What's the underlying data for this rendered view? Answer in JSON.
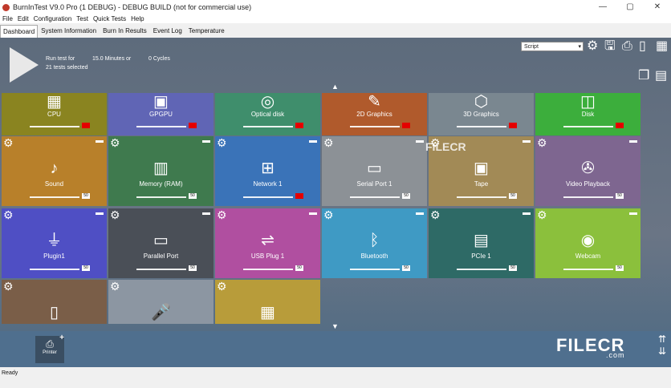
{
  "window": {
    "title": "BurnInTest V9.0 Pro (1 DEBUG) - DEBUG BUILD (not for commercial use)",
    "min": "—",
    "max": "▢",
    "close": "✕"
  },
  "menu": [
    "File",
    "Edit",
    "Configuration",
    "Test",
    "Quick Tests",
    "Help"
  ],
  "tabs": [
    "Dashboard",
    "System Information",
    "Burn In Results",
    "Event Log",
    "Temperature"
  ],
  "run": {
    "label1": "Run test for",
    "duration": "15.0 Minutes or",
    "cycles": "0 Cycles",
    "label2": "21 tests selected"
  },
  "script_select": "Script",
  "tiles": [
    {
      "name": "CPU",
      "icon": "▦",
      "icon_name": "cpu-chip-icon",
      "color": "#8a8420",
      "badge": "",
      "err": true
    },
    {
      "name": "GPGPU",
      "icon": "▣",
      "icon_name": "gpu-card-icon",
      "color": "#6065b5",
      "badge": "",
      "err": true
    },
    {
      "name": "Optical disk",
      "icon": "◎",
      "icon_name": "optical-disc-icon",
      "color": "#3f8e6c",
      "badge": "",
      "err": true
    },
    {
      "name": "2D Graphics",
      "icon": "✎",
      "icon_name": "easel-icon",
      "color": "#b05a2c",
      "badge": "",
      "err": true
    },
    {
      "name": "3D Graphics",
      "icon": "⬡",
      "icon_name": "cubes-icon",
      "color": "#7a8790",
      "badge": "",
      "err": true
    },
    {
      "name": "Disk",
      "icon": "◫",
      "icon_name": "hard-disk-icon",
      "color": "#3cae3c",
      "badge": "",
      "err": true
    },
    {
      "name": "Sound",
      "icon": "♪",
      "icon_name": "speaker-icon",
      "color": "#b8802a",
      "badge": "50",
      "err": false
    },
    {
      "name": "Memory (RAM)",
      "icon": "▥",
      "icon_name": "ram-module-icon",
      "color": "#3f7a4e",
      "badge": "50",
      "err": false
    },
    {
      "name": "Network 1",
      "icon": "⊞",
      "icon_name": "network-icon",
      "color": "#3a73b8",
      "badge": "",
      "err": true
    },
    {
      "name": "Serial Port 1",
      "icon": "▭",
      "icon_name": "serial-port-icon",
      "color": "#8c9196",
      "badge": "50",
      "err": false
    },
    {
      "name": "Tape",
      "icon": "▣",
      "icon_name": "tape-cassette-icon",
      "color": "#a28a56",
      "badge": "50",
      "err": false
    },
    {
      "name": "Video Playback",
      "icon": "✇",
      "icon_name": "film-reel-icon",
      "color": "#7e6690",
      "badge": "50",
      "err": false
    },
    {
      "name": "Plugin1",
      "icon": "⏚",
      "icon_name": "plug-icon",
      "color": "#4f4fc4",
      "badge": "50",
      "err": false
    },
    {
      "name": "Parallel Port",
      "icon": "▭",
      "icon_name": "parallel-port-icon",
      "color": "#4a4f57",
      "badge": "50",
      "err": false
    },
    {
      "name": "USB Plug 1",
      "icon": "⇌",
      "icon_name": "usb-plug-icon",
      "color": "#b04fa0",
      "badge": "50",
      "err": false
    },
    {
      "name": "Bluetooth",
      "icon": "ᛒ",
      "icon_name": "bluetooth-icon",
      "color": "#3f9ac4",
      "badge": "50",
      "err": false
    },
    {
      "name": "PCIe 1",
      "icon": "▤",
      "icon_name": "pcie-card-icon",
      "color": "#2e6a66",
      "badge": "50",
      "err": false
    },
    {
      "name": "Webcam",
      "icon": "◉",
      "icon_name": "webcam-icon",
      "color": "#8bc03c",
      "badge": "50",
      "err": false
    },
    {
      "name": "",
      "icon": "▯",
      "icon_name": "battery-icon",
      "color": "#7a5e48",
      "badge": "",
      "err": false
    },
    {
      "name": "",
      "icon": "🎤",
      "icon_name": "microphone-icon",
      "color": "#8c96a2",
      "badge": "",
      "err": false
    },
    {
      "name": "",
      "icon": "▦",
      "icon_name": "printer-icon",
      "color": "#b89c3a",
      "badge": "",
      "err": false
    }
  ],
  "footer": {
    "printer_label": "Printer"
  },
  "watermark": {
    "main": "FILECR",
    "sub": ".com"
  },
  "status": "Ready"
}
